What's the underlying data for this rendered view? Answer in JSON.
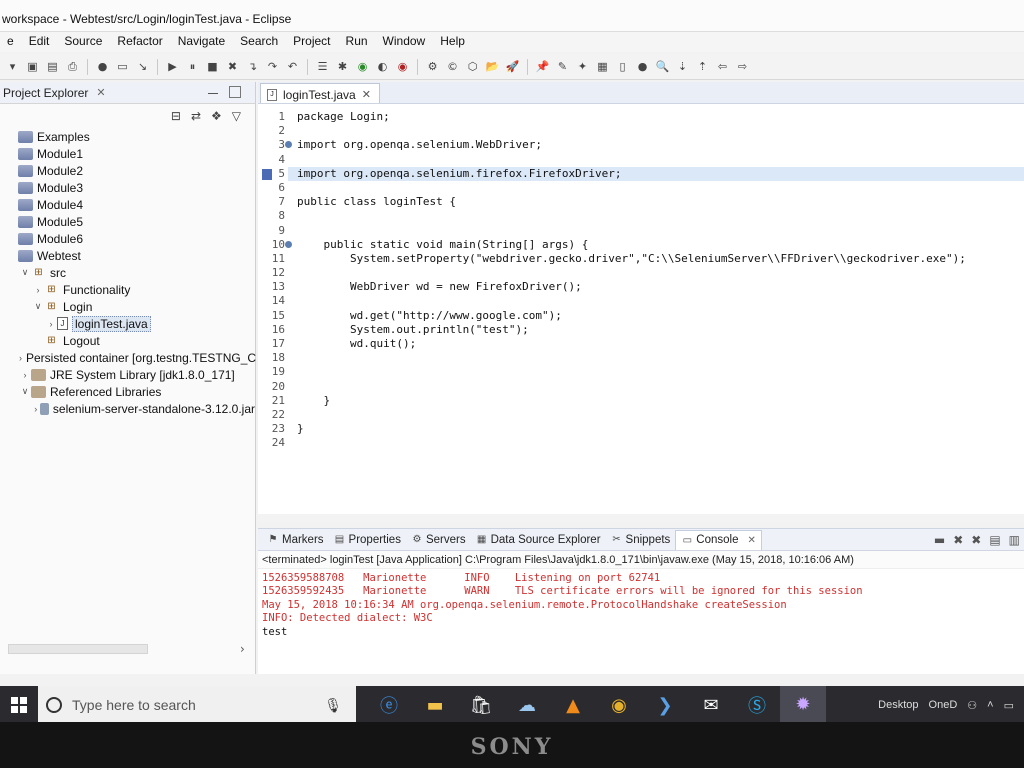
{
  "window": {
    "title": "workspace - Webtest/src/Login/loginTest.java - Eclipse"
  },
  "menu": [
    "e",
    "Edit",
    "Source",
    "Refactor",
    "Navigate",
    "Search",
    "Project",
    "Run",
    "Window",
    "Help"
  ],
  "project_explorer": {
    "tab_label": "Project Explorer",
    "items": [
      {
        "label": "Examples",
        "icon": "project-icon",
        "depth": 0,
        "twisty": ""
      },
      {
        "label": "Module1",
        "icon": "project-icon",
        "depth": 0,
        "twisty": ""
      },
      {
        "label": "Module2",
        "icon": "project-icon",
        "depth": 0,
        "twisty": ""
      },
      {
        "label": "Module3",
        "icon": "project-icon",
        "depth": 0,
        "twisty": ""
      },
      {
        "label": "Module4",
        "icon": "project-icon",
        "depth": 0,
        "twisty": ""
      },
      {
        "label": "Module5",
        "icon": "project-icon",
        "depth": 0,
        "twisty": ""
      },
      {
        "label": "Module6",
        "icon": "project-icon",
        "depth": 0,
        "twisty": ""
      },
      {
        "label": "Webtest",
        "icon": "project-icon",
        "depth": 0,
        "twisty": ""
      },
      {
        "label": "src",
        "icon": "source-folder-icon",
        "depth": 1,
        "twisty": "expanded"
      },
      {
        "label": "Functionality",
        "icon": "package-icon",
        "depth": 2,
        "twisty": "collapsed"
      },
      {
        "label": "Login",
        "icon": "package-icon",
        "depth": 2,
        "twisty": "expanded"
      },
      {
        "label": "loginTest.java",
        "icon": "java-file-icon",
        "depth": 3,
        "twisty": "collapsed",
        "selected": true
      },
      {
        "label": "Logout",
        "icon": "package-icon",
        "depth": 2,
        "twisty": ""
      },
      {
        "label": "Persisted container [org.testng.TESTNG_C",
        "icon": "library-icon",
        "depth": 1,
        "twisty": "collapsed"
      },
      {
        "label": "JRE System Library [jdk1.8.0_171]",
        "icon": "library-icon",
        "depth": 1,
        "twisty": "collapsed"
      },
      {
        "label": "Referenced Libraries",
        "icon": "library-icon",
        "depth": 1,
        "twisty": "expanded"
      },
      {
        "label": "selenium-server-standalone-3.12.0.jar",
        "icon": "jar-icon",
        "depth": 2,
        "twisty": "collapsed"
      }
    ]
  },
  "editor": {
    "tab_label": "loginTest.java",
    "highlighted_line": 5,
    "lines": [
      {
        "n": "1",
        "text": "package Login;"
      },
      {
        "n": "2",
        "text": ""
      },
      {
        "n": "3",
        "text": "import org.openqa.selenium.WebDriver;",
        "fold": true
      },
      {
        "n": "4",
        "text": ""
      },
      {
        "n": "5",
        "text": "import org.openqa.selenium.firefox.FirefoxDriver;"
      },
      {
        "n": "6",
        "text": ""
      },
      {
        "n": "7",
        "text": "public class loginTest {"
      },
      {
        "n": "8",
        "text": ""
      },
      {
        "n": "9",
        "text": ""
      },
      {
        "n": "10",
        "text": "    public static void main(String[] args) {",
        "fold": true
      },
      {
        "n": "11",
        "text": "        System.setProperty(\"webdriver.gecko.driver\",\"C:\\\\SeleniumServer\\\\FFDriver\\\\geckodriver.exe\");"
      },
      {
        "n": "12",
        "text": ""
      },
      {
        "n": "13",
        "text": "        WebDriver wd = new FirefoxDriver();"
      },
      {
        "n": "14",
        "text": ""
      },
      {
        "n": "15",
        "text": "        wd.get(\"http://www.google.com\");"
      },
      {
        "n": "16",
        "text": "        System.out.println(\"test\");"
      },
      {
        "n": "17",
        "text": "        wd.quit();"
      },
      {
        "n": "18",
        "text": ""
      },
      {
        "n": "19",
        "text": ""
      },
      {
        "n": "20",
        "text": ""
      },
      {
        "n": "21",
        "text": "    }"
      },
      {
        "n": "22",
        "text": ""
      },
      {
        "n": "23",
        "text": "}"
      },
      {
        "n": "24",
        "text": ""
      }
    ]
  },
  "bottom_panel": {
    "tabs": [
      {
        "label": "Markers",
        "icon": "markers-icon"
      },
      {
        "label": "Properties",
        "icon": "properties-icon"
      },
      {
        "label": "Servers",
        "icon": "servers-icon"
      },
      {
        "label": "Data Source Explorer",
        "icon": "data-source-icon"
      },
      {
        "label": "Snippets",
        "icon": "snippets-icon"
      },
      {
        "label": "Console",
        "icon": "console-icon",
        "active": true
      }
    ],
    "console_header": "<terminated> loginTest [Java Application] C:\\Program Files\\Java\\jdk1.8.0_171\\bin\\javaw.exe (May 15, 2018, 10:16:06 AM)",
    "console_lines": [
      {
        "text": "1526359588708   Marionette      INFO    Listening on port 62741",
        "kind": "err"
      },
      {
        "text": "1526359592435   Marionette      WARN    TLS certificate errors will be ignored for this session",
        "kind": "err"
      },
      {
        "text": "May 15, 2018 10:16:34 AM org.openqa.selenium.remote.ProtocolHandshake createSession",
        "kind": "err"
      },
      {
        "text": "INFO: Detected dialect: W3C",
        "kind": "err"
      },
      {
        "text": "test",
        "kind": "out"
      }
    ]
  },
  "taskbar": {
    "search_placeholder": "Type here to search",
    "tray_desktop": "Desktop",
    "tray_onedrive": "OneD"
  },
  "bezel_brand": "SONY",
  "colors": {
    "editor_highlight": "#dbe8f8",
    "console_error": "#d03030",
    "taskbar": "#2b2b2f"
  }
}
